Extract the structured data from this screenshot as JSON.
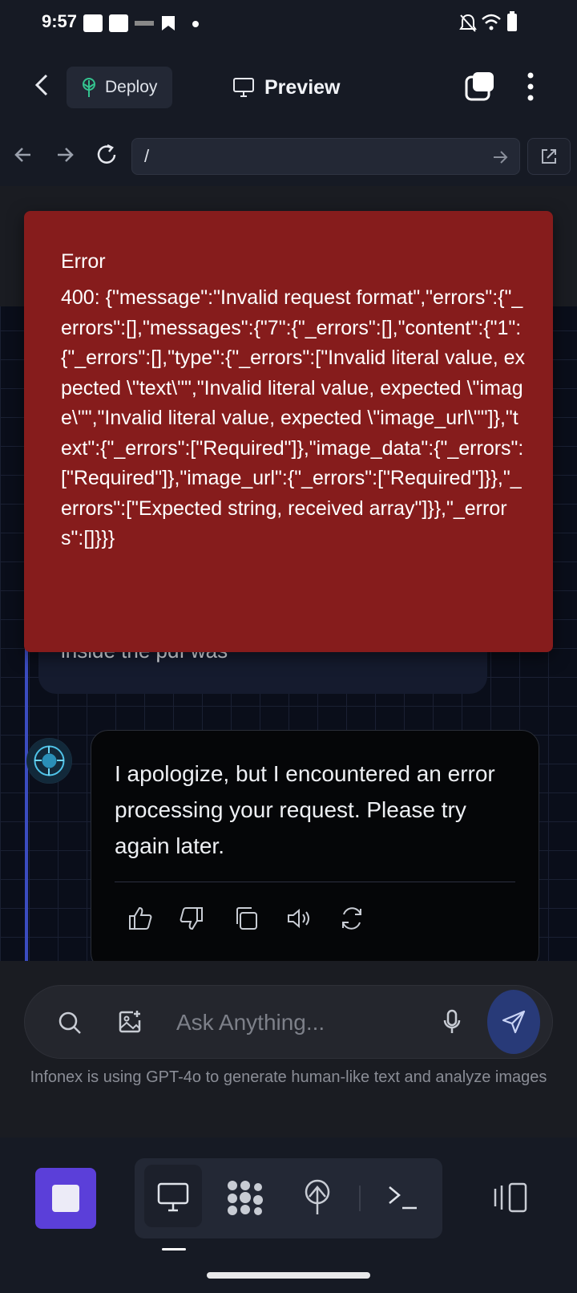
{
  "status_bar": {
    "time": "9:57",
    "app_icons": [
      "paytm-icon",
      "updates-icon",
      "ninja-icon",
      "bookmark-icon"
    ]
  },
  "header": {
    "deploy_label": "Deploy",
    "preview_label": "Preview"
  },
  "url_bar": {
    "path": "/"
  },
  "error_toast": {
    "title": "Error",
    "message": "400: {\"message\":\"Invalid request format\",\"errors\":{\"_errors\":[],\"messages\":{\"7\":{\"_errors\":[],\"content\":{\"1\":{\"_errors\":[],\"type\":{\"_errors\":[\"Invalid literal value, expected \\\"text\\\"\",\"Invalid literal value, expected \\\"image\\\"\",\"Invalid literal value, expected \\\"image_url\\\"\"]},\"text\":{\"_errors\":[\"Required\"]},\"image_data\":{\"_errors\":[\"Required\"]},\"image_url\":{\"_errors\":[\"Required\"]}},\"_errors\":[\"Expected string, received array\"]}},\"_errors\":[]}}}"
  },
  "chat": {
    "user_message_visible": "inside the pdf was",
    "assistant_message": "I apologize, but I encountered an error processing your request. Please try again later.",
    "actions": [
      "like-icon",
      "dislike-icon",
      "copy-icon",
      "speaker-icon",
      "regenerate-icon"
    ]
  },
  "composer": {
    "placeholder": "Ask Anything...",
    "disclaimer": "Infonex is using GPT-4o to generate human-like text and analyze images"
  },
  "colors": {
    "error_bg": "#861c1c",
    "accent_purple": "#5b3fd9",
    "send_button": "#283a78"
  }
}
